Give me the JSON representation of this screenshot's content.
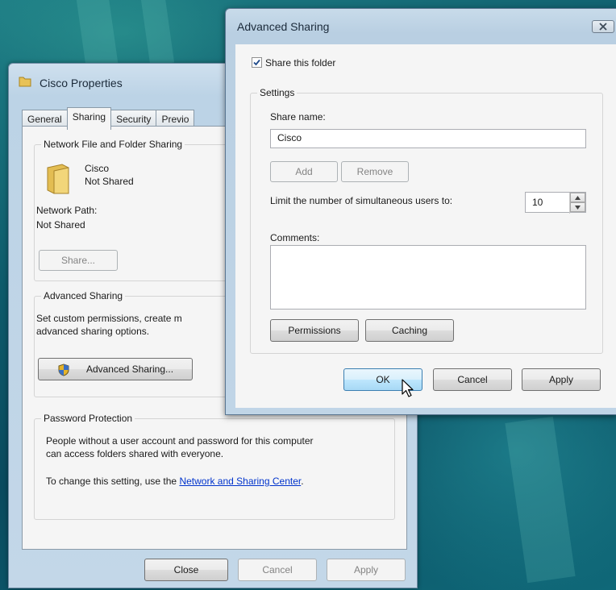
{
  "properties": {
    "title": "Cisco Properties",
    "tabs": [
      {
        "label": "General",
        "active": false
      },
      {
        "label": "Sharing",
        "active": true
      },
      {
        "label": "Security",
        "active": false
      },
      {
        "label": "Previo",
        "active": false
      }
    ],
    "network_group": {
      "label": "Network File and Folder Sharing",
      "folder_name": "Cisco",
      "folder_status": "Not Shared",
      "path_label": "Network Path:",
      "path_value": "Not Shared",
      "share_button": "Share..."
    },
    "advanced_group": {
      "label": "Advanced Sharing",
      "description_line1": "Set custom permissions, create m",
      "description_line2": "advanced sharing options.",
      "button": "Advanced Sharing..."
    },
    "password_group": {
      "label": "Password Protection",
      "text_line1": "People without a user account and password for this computer",
      "text_line2": "can access folders shared with everyone.",
      "change_prefix": "To change this setting, use the ",
      "link": "Network and Sharing Center",
      "change_suffix": "."
    },
    "buttons": {
      "close": "Close",
      "cancel": "Cancel",
      "apply": "Apply"
    }
  },
  "advanced_sharing": {
    "title": "Advanced Sharing",
    "share_checkbox_label": "Share this folder",
    "share_checked": true,
    "settings_label": "Settings",
    "share_name_label": "Share name:",
    "share_name_value": "Cisco",
    "add_button": "Add",
    "remove_button": "Remove",
    "limit_label": "Limit the number of simultaneous users to:",
    "limit_value": "10",
    "comments_label": "Comments:",
    "comments_value": "",
    "permissions_button": "Permissions",
    "caching_button": "Caching",
    "ok_button": "OK",
    "cancel_button": "Cancel",
    "apply_button": "Apply"
  },
  "colors": {
    "link": "#0033cc",
    "title_bar": "#bcd3e6",
    "desktop": "#0d5a6c"
  }
}
